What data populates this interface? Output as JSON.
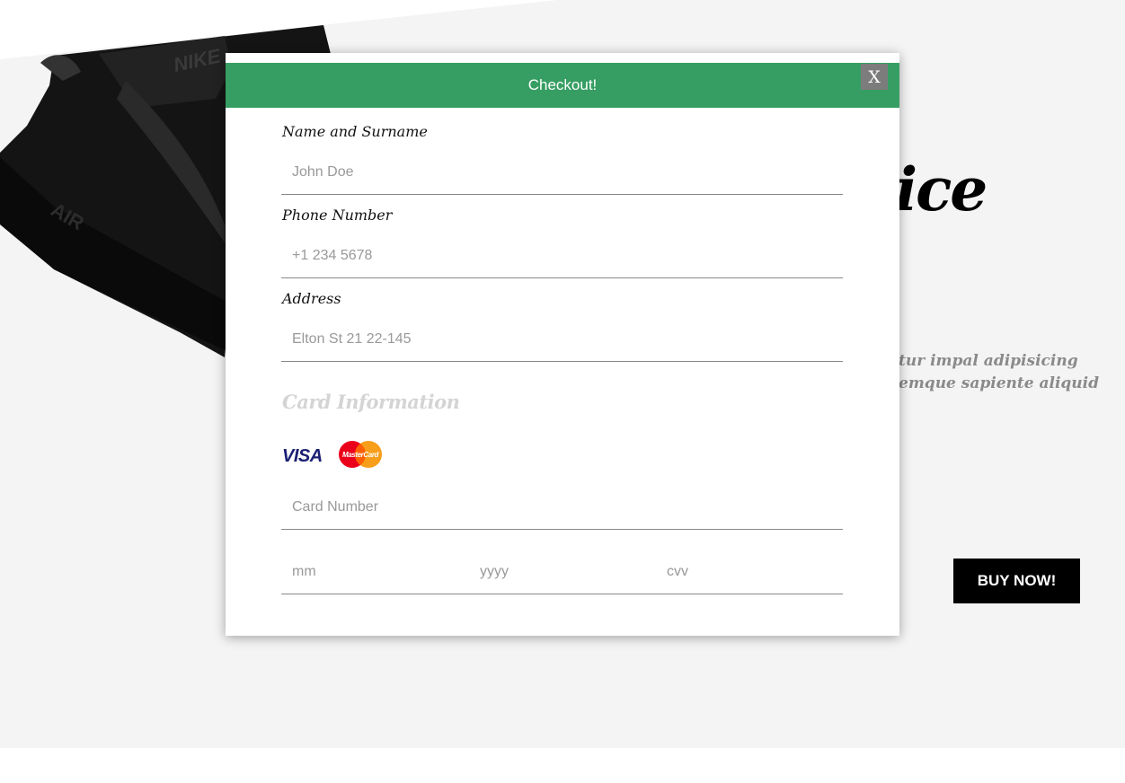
{
  "hero": {
    "title_fragment": "ice",
    "desc_line1": "tur impal adipisicing",
    "desc_line2": "emque sapiente aliquid",
    "buy_label": "BUY NOW!"
  },
  "modal": {
    "title": "Checkout!",
    "close_label": "X",
    "name_label": "Name and Surname",
    "name_placeholder": "John Doe",
    "phone_label": "Phone Number",
    "phone_placeholder": "+1 234 5678",
    "address_label": "Address",
    "address_placeholder": "Elton St 21 22-145",
    "card_heading": "Card Information",
    "visa_text": "VISA",
    "mastercard_text": "MasterCard",
    "card_number_placeholder": "Card Number",
    "month_placeholder": "mm",
    "year_placeholder": "yyyy",
    "cvv_placeholder": "cvv",
    "header_color": "#369e62"
  }
}
